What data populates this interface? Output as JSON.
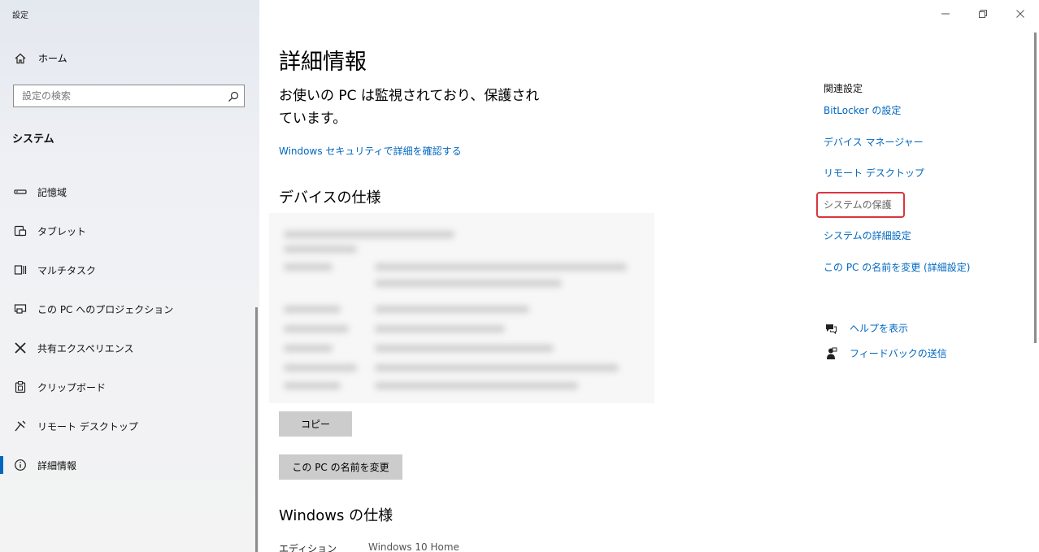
{
  "window": {
    "title": "設定",
    "minimize": "—",
    "restore": "❐",
    "close": "✕"
  },
  "sidebar": {
    "home_label": "ホーム",
    "search_placeholder": "設定の検索",
    "section_title": "システム",
    "items": [
      {
        "label": "記憶域",
        "icon": "storage-icon"
      },
      {
        "label": "タブレット",
        "icon": "tablet-icon"
      },
      {
        "label": "マルチタスク",
        "icon": "multitasking-icon"
      },
      {
        "label": "この PC へのプロジェクション",
        "icon": "projection-icon"
      },
      {
        "label": "共有エクスペリエンス",
        "icon": "shared-experiences-icon"
      },
      {
        "label": "クリップボード",
        "icon": "clipboard-icon"
      },
      {
        "label": "リモート デスクトップ",
        "icon": "remote-desktop-icon"
      },
      {
        "label": "詳細情報",
        "icon": "info-icon",
        "active": true
      }
    ]
  },
  "main": {
    "title": "詳細情報",
    "status_line1": "お使いの PC は監視されており、保護され",
    "status_line2": "ています。",
    "security_link": "Windows セキュリティで詳細を確認する",
    "device_spec_heading": "デバイスの仕様",
    "copy_button": "コピー",
    "rename_button": "この PC の名前を変更",
    "windows_spec_heading": "Windows の仕様",
    "edition_label": "エディション",
    "edition_value": "Windows 10 Home"
  },
  "related": {
    "title": "関連設定",
    "links": [
      {
        "label": "BitLocker の設定"
      },
      {
        "label": "デバイス マネージャー"
      },
      {
        "label": "リモート デスクトップ"
      },
      {
        "label": "システムの保護",
        "highlighted": true
      },
      {
        "label": "システムの詳細設定"
      },
      {
        "label": "この PC の名前を変更 (詳細設定)"
      }
    ]
  },
  "help": {
    "items": [
      {
        "label": "ヘルプを表示",
        "icon": "help-chat-icon"
      },
      {
        "label": "フィードバックの送信",
        "icon": "feedback-icon"
      }
    ]
  },
  "colors": {
    "link": "#0067c0",
    "highlight_border": "#d9363e",
    "button_bg": "#cccccc"
  }
}
